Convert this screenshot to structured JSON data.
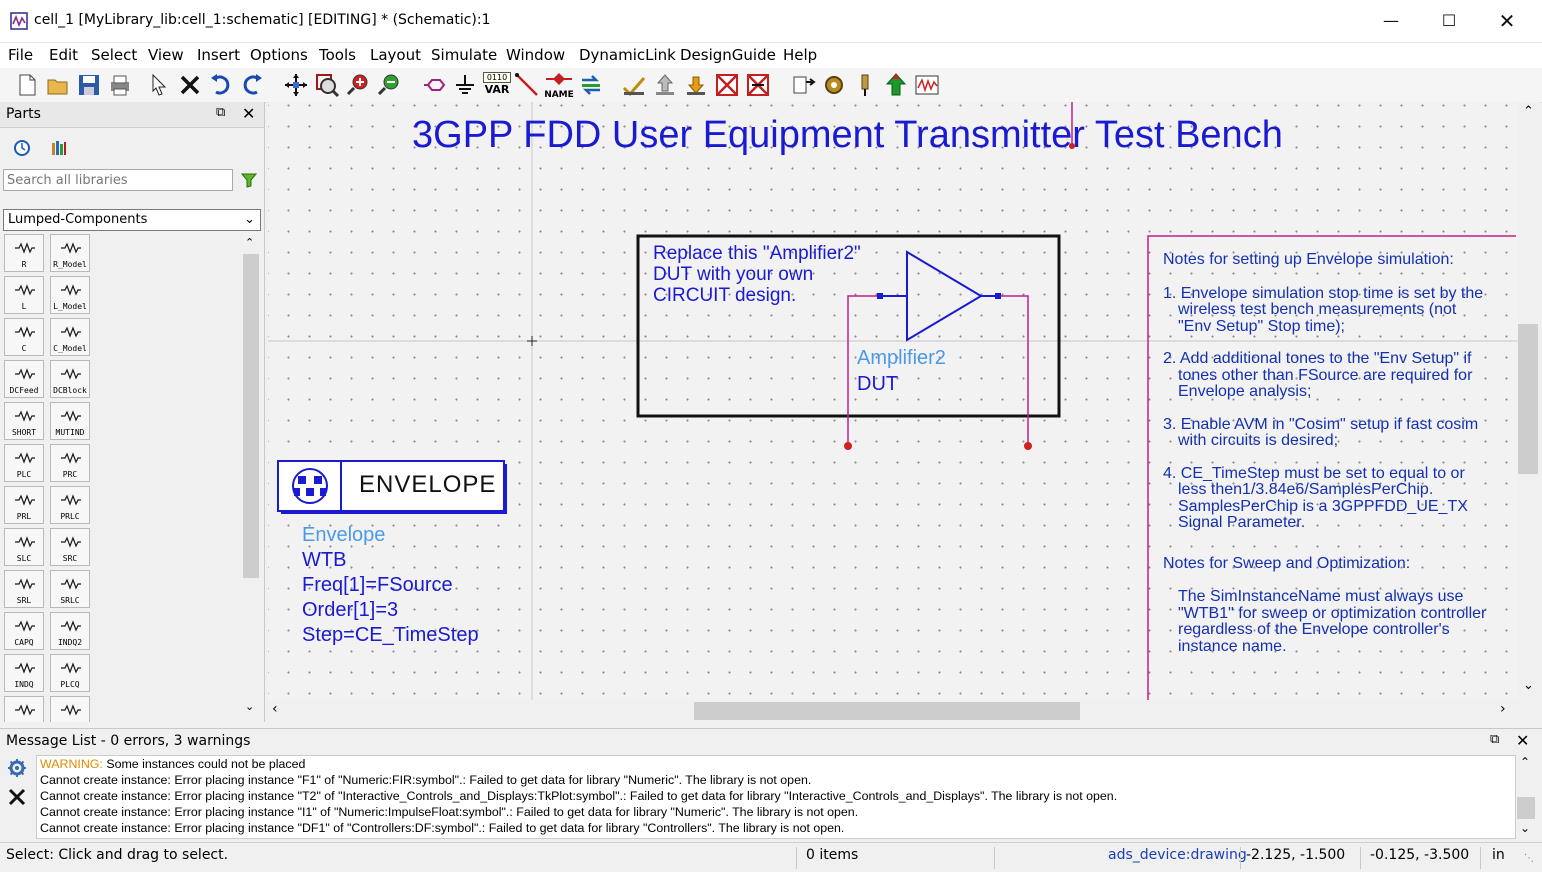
{
  "window": {
    "title": "cell_1 [MyLibrary_lib:cell_1:schematic] [EDITING] * (Schematic):1",
    "controls": [
      "minimize-icon",
      "maximize-icon",
      "close-icon"
    ]
  },
  "menu": {
    "items": [
      "File",
      "Edit",
      "Select",
      "View",
      "Insert",
      "Options",
      "Tools",
      "Layout",
      "Simulate",
      "Window",
      "DynamicLink",
      "DesignGuide",
      "Help"
    ]
  },
  "toolbar": {
    "var_label": "VAR",
    "var_bits": "0110",
    "name_label": "NAME"
  },
  "parts_panel": {
    "title": "Parts",
    "search_placeholder": "Search all libraries",
    "library": "Lumped-Components",
    "components": [
      {
        "left": "R",
        "right": "R_Model"
      },
      {
        "left": "L",
        "right": "L_Model"
      },
      {
        "left": "C",
        "right": "C_Model"
      },
      {
        "left": "DCFeed",
        "right": "DCBlock"
      },
      {
        "left": "SHORT",
        "right": "MUTIND"
      },
      {
        "left": "PLC",
        "right": "PRC"
      },
      {
        "left": "PRL",
        "right": "PRLC"
      },
      {
        "left": "SLC",
        "right": "SRC"
      },
      {
        "left": "SRL",
        "right": "SRLC"
      },
      {
        "left": "CAPQ",
        "right": "INDQ2"
      },
      {
        "left": "INDQ",
        "right": "PLCQ"
      },
      {
        "left": "",
        "right": ""
      }
    ]
  },
  "schematic": {
    "title": "3GPP FDD User Equipment Transmitter Test Bench",
    "dut_box_text": [
      "Replace this \"Amplifier2\"",
      "DUT with your own",
      "CIRCUIT design."
    ],
    "amplifier_name": "Amplifier2",
    "amplifier_instance": "DUT",
    "envelope_button": "ENVELOPE",
    "envelope_params": [
      "WTB",
      "Freq[1]=FSource",
      "Order[1]=3",
      "Step=CE_TimeStep"
    ],
    "envelope_type": "Envelope",
    "notes_title": "Notes for setting up Envelope simulation:",
    "notes": [
      [
        "1. Envelope simulation stop time is set by the",
        "wireless test bench measurements (not",
        "\"Env Setup\" Stop time);"
      ],
      [
        "2. Add additional tones to the \"Env Setup\" if",
        "tones other than FSource are required for",
        "Envelope analysis;"
      ],
      [
        "3. Enable AVM in \"Cosim\" setup if fast cosim",
        "with circuits is desired;"
      ],
      [
        "4. CE_TimeStep must be set to equal to or",
        "less then1/3.84e6/SamplesPerChip.",
        "SamplesPerChip is a 3GPPFDD_UE_TX",
        "Signal Parameter."
      ]
    ],
    "sweep_title": "Notes for Sweep and Optimization:",
    "sweep_text": [
      "The SimInstanceName must always use",
      "\"WTB1\" for sweep or optimization controller",
      "regardless of the Envelope controller's",
      "instance name."
    ]
  },
  "messages": {
    "header": "Message List - 0 errors, 3 warnings",
    "warning_prefix": "WARNING:",
    "warning_text": "Some instances could not be placed",
    "lines": [
      "Cannot create instance: Error placing instance \"F1\" of \"Numeric:FIR:symbol\".: Failed to get data for library \"Numeric\". The library is not open.",
      "Cannot create instance: Error placing instance \"T2\" of \"Interactive_Controls_and_Displays:TkPlot:symbol\".: Failed to get data for library \"Interactive_Controls_and_Displays\". The library is not open.",
      "Cannot create instance: Error placing instance \"I1\" of \"Numeric:ImpulseFloat:symbol\".: Failed to get data for library \"Numeric\". The library is not open.",
      "Cannot create instance: Error placing instance \"DF1\" of \"Controllers:DF:symbol\".: Failed to get data for library \"Controllers\". The library is not open."
    ]
  },
  "status": {
    "hint": "Select: Click and drag to select.",
    "items": "0 items",
    "layer": "ads_device:drawing",
    "coord1": "-2.125, -1.500",
    "coord2": "-0.125, -3.500",
    "units": "in"
  },
  "colors": {
    "schematic_blue": "#1a1ad0",
    "label_blue": "#4a9ae8",
    "wire_magenta": "#c0208a",
    "note_blue": "#1530b0"
  }
}
